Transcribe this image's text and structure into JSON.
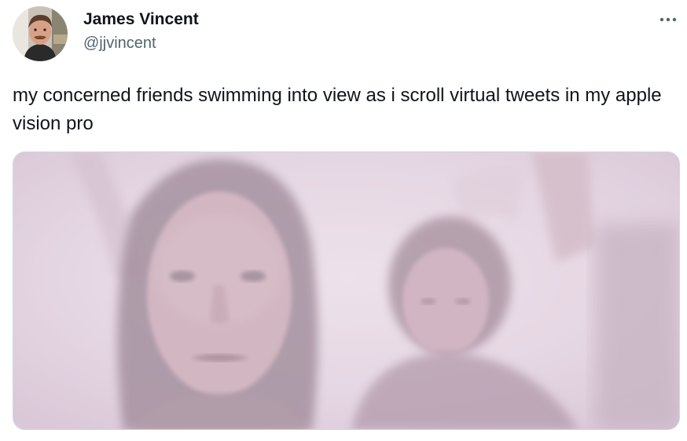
{
  "tweet": {
    "author": {
      "display_name": "James Vincent",
      "handle": "@jjvincent",
      "avatar_icon": "profile-photo"
    },
    "more_icon": "more-horizontal-icon",
    "text": "my concerned friends swimming into view as i scroll virtual tweets in my apple vision pro",
    "media": {
      "type": "photo",
      "tint": "#e4d4e2"
    }
  },
  "colors": {
    "text_primary": "#0f1419",
    "text_secondary": "#536471",
    "border": "#cfd9de"
  }
}
